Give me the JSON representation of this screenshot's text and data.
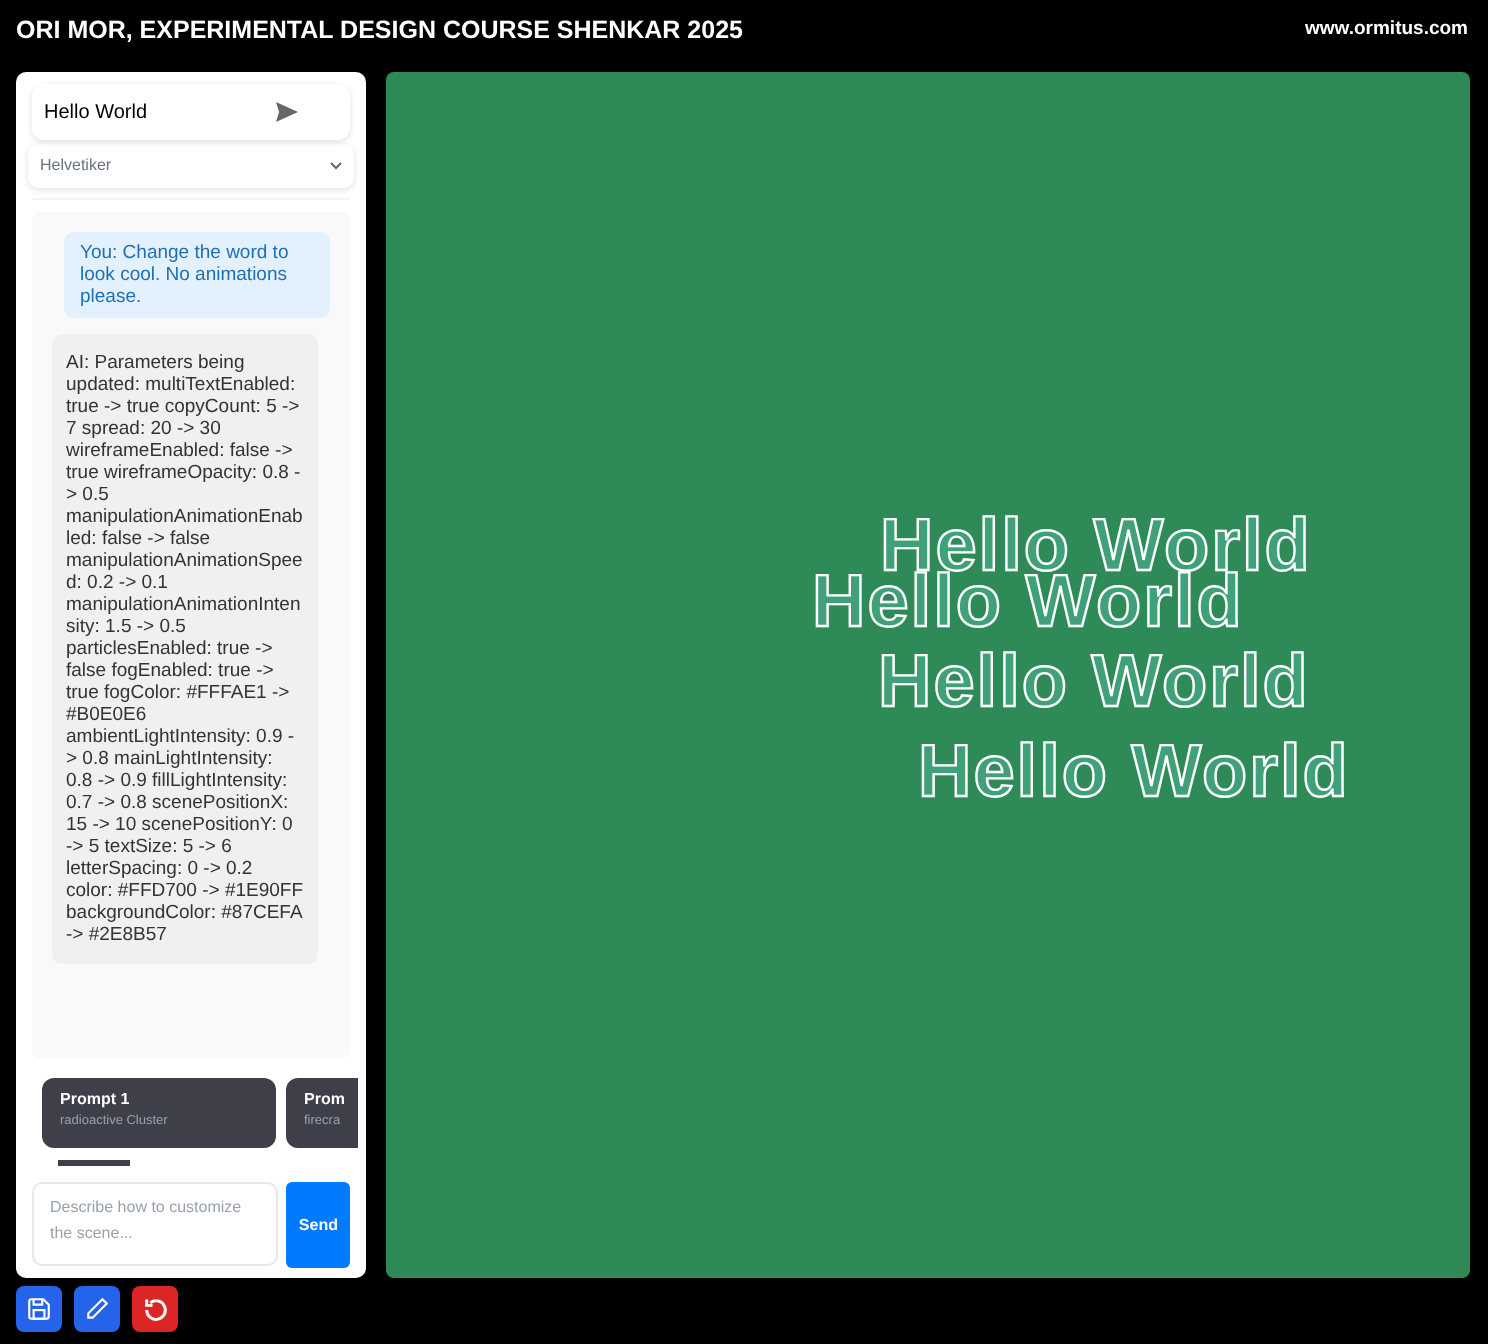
{
  "header": {
    "title": "ORI MOR, EXPERIMENTAL DESIGN COURSE SHENKAR 2025",
    "link": "www.ormitus.com"
  },
  "text_input": {
    "value": "Hello World"
  },
  "font_select": {
    "value": "Helvetiker"
  },
  "messages": [
    {
      "kind": "user",
      "text": "You: Change the word to look cool. No animations please."
    },
    {
      "kind": "ai",
      "text": "AI: Parameters being updated: multiTextEnabled: true -> true copyCount: 5 -> 7 spread: 20 -> 30 wireframeEnabled: false -> true wireframeOpacity: 0.8 -> 0.5 manipulationAnimationEnabled: false -> false manipulationAnimationSpeed: 0.2 -> 0.1 manipulationAnimationIntensity: 1.5 -> 0.5 particlesEnabled: true -> false fogEnabled: true -> true fogColor: #FFFAE1 -> #B0E0E6 ambientLightIntensity: 0.9 -> 0.8 mainLightIntensity: 0.8 -> 0.9 fillLightIntensity: 0.7 -> 0.8 scenePositionX: 15 -> 10 scenePositionY: 0 -> 5 textSize: 5 -> 6 letterSpacing: 0 -> 0.2 color: #FFD700 -> #1E90FF backgroundColor: #87CEFA -> #2E8B57"
    }
  ],
  "prompts": [
    {
      "title": "Prompt 1",
      "subtitle": "radioactive Cluster"
    },
    {
      "title": "Prom",
      "subtitle": "firecra"
    }
  ],
  "prompt_input": {
    "placeholder": "Describe how to customize the scene..."
  },
  "send_button": "Send",
  "scene": {
    "copies": [
      "Hello World",
      "Hello World",
      "Hello World",
      "Hello World"
    ]
  }
}
